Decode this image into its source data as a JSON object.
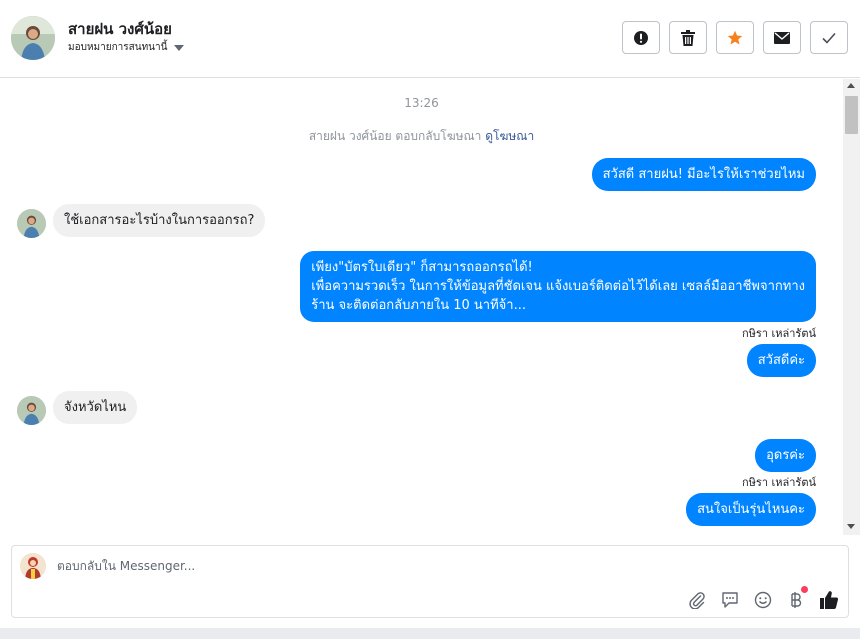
{
  "header": {
    "contact_name": "สายฝน วงศ์น้อย",
    "assign_label": "มอบหมายการสนทนานี้",
    "actions": [
      {
        "name": "mark-spam-button",
        "icon": "exclamation-icon"
      },
      {
        "name": "delete-button",
        "icon": "trash-icon"
      },
      {
        "name": "star-button",
        "icon": "star-icon"
      },
      {
        "name": "mark-unread-button",
        "icon": "envelope-icon"
      },
      {
        "name": "mark-done-button",
        "icon": "checkmark-icon"
      }
    ]
  },
  "chat": {
    "timestamp": "13:26",
    "system_text": "สายฝน วงศ์น้อย ตอบกลับโฆษณา",
    "system_link": "ดูโฆษณา",
    "messages": [
      {
        "direction": "out",
        "text": "สวัสดี สายฝน! มีอะไรให้เราช่วยไหม"
      },
      {
        "direction": "in",
        "text": "ใช้เอกสารอะไรบ้างในการออกรถ?"
      },
      {
        "direction": "out",
        "lines": [
          "เพียง\"บัตรใบเดียว\" ก็สามารถออกรถได้!",
          "เพื่อความรวดเร็ว ในการให้ข้อมูลที่ชัดเจน แจ้งเบอร์ติดต่อไว้ได้เลย เซลล์มืออาชีพจากทาง",
          "ร้าน จะติดต่อกลับภายใน 10 นาทีจ้า..."
        ]
      },
      {
        "direction": "out",
        "sender": "กษิรา เหล่ารัตน์",
        "text": "สวัสดีค่ะ"
      },
      {
        "direction": "in",
        "text": "จังหวัดไหน"
      },
      {
        "direction": "out",
        "text": "อุดรค่ะ"
      },
      {
        "direction": "out",
        "sender": "กษิรา เหล่ารัตน์",
        "text": "สนใจเป็นรุ่นไหนคะ"
      }
    ]
  },
  "composer": {
    "placeholder": "ตอบกลับใน Messenger...",
    "tools": [
      "paperclip-icon",
      "saved-reply-icon",
      "emoji-icon",
      "baht-payment-icon",
      "thumbs-up-icon"
    ]
  },
  "colors": {
    "accent": "#0084ff",
    "incoming_bubble": "#f1f0f0",
    "star": "#f5821f",
    "notification_dot": "#fa3e5f"
  }
}
